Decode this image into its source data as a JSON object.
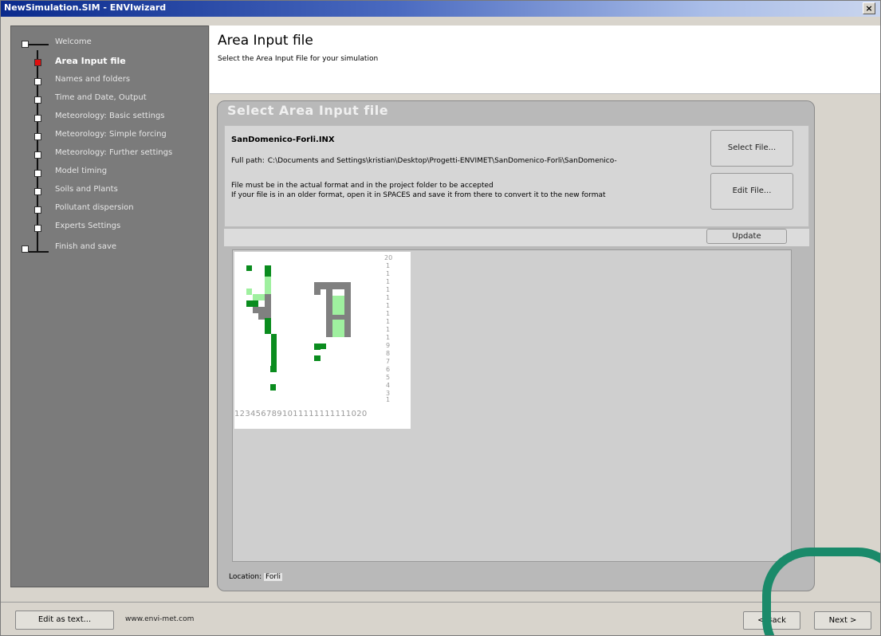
{
  "window": {
    "title": "NewSimulation.SIM - ENVIwizard",
    "close_glyph": "×"
  },
  "steps": [
    {
      "label": "Welcome",
      "active": false
    },
    {
      "label": "Area Input file",
      "active": true
    },
    {
      "label": "Names and folders",
      "active": false
    },
    {
      "label": "Time and Date, Output",
      "active": false
    },
    {
      "label": "Meteorology: Basic settings",
      "active": false
    },
    {
      "label": "Meteorology: Simple forcing",
      "active": false
    },
    {
      "label": "Meteorology: Further settings",
      "active": false
    },
    {
      "label": "Model timing",
      "active": false
    },
    {
      "label": "Soils and Plants",
      "active": false
    },
    {
      "label": "Pollutant dispersion",
      "active": false
    },
    {
      "label": "Experts Settings",
      "active": false
    },
    {
      "label": "Finish and save",
      "active": false
    }
  ],
  "header": {
    "title": "Area Input file",
    "subtitle": "Select the Area Input File for your simulation"
  },
  "panel": {
    "title": "Select Area Input file",
    "file_name": "SanDomenico-Forli.INX",
    "full_path_label": "Full path:",
    "full_path_value": "C:\\Documents and Settings\\kristian\\Desktop\\Progetti-ENVIMET\\SanDomenico-Forli\\SanDomenico-",
    "message_line1": "File must be in the actual format and in the project folder to be accepted",
    "message_line2": "If your file is in an older format, open it in SPACES and save it from there to convert it to the new format",
    "select_file_label": "Select File...",
    "edit_file_label": "Edit File...",
    "update_label": "Update",
    "x_axis_labels": "1234567891011111111111020",
    "location_label": "Location:",
    "location_value": "Forli"
  },
  "footer": {
    "edit_as_text_label": "Edit as text...",
    "url": "www.envi-met.com",
    "back_label": "< Back",
    "next_label": "Next >"
  },
  "colors": {
    "accent_active": "#e01010",
    "dark_green": "#0a8c1e",
    "light_green": "#9ff09f",
    "gray_cell": "#808080",
    "annotation_ring": "#1a8a6a"
  }
}
